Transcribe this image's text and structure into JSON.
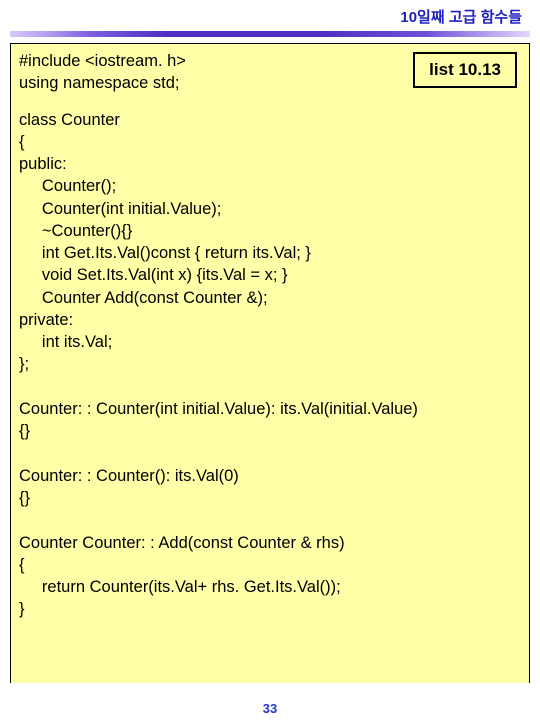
{
  "header": {
    "title": "10일째 고급 함수들"
  },
  "listbox": {
    "label": "list 10.13"
  },
  "code": {
    "includes": "#include <iostream. h>\nusing namespace std;",
    "body": "class Counter\n{\npublic:\n     Counter();\n     Counter(int initial.Value);\n     ~Counter(){}\n     int Get.Its.Val()const { return its.Val; }\n     void Set.Its.Val(int x) {its.Val = x; }\n     Counter Add(const Counter &);\nprivate:\n     int its.Val;\n};\n\nCounter: : Counter(int initial.Value): its.Val(initial.Value)\n{}\n\nCounter: : Counter(): its.Val(0)\n{}\n\nCounter Counter: : Add(const Counter & rhs)\n{\n     return Counter(its.Val+ rhs. Get.Its.Val());\n}"
  },
  "page": {
    "number": "33"
  }
}
